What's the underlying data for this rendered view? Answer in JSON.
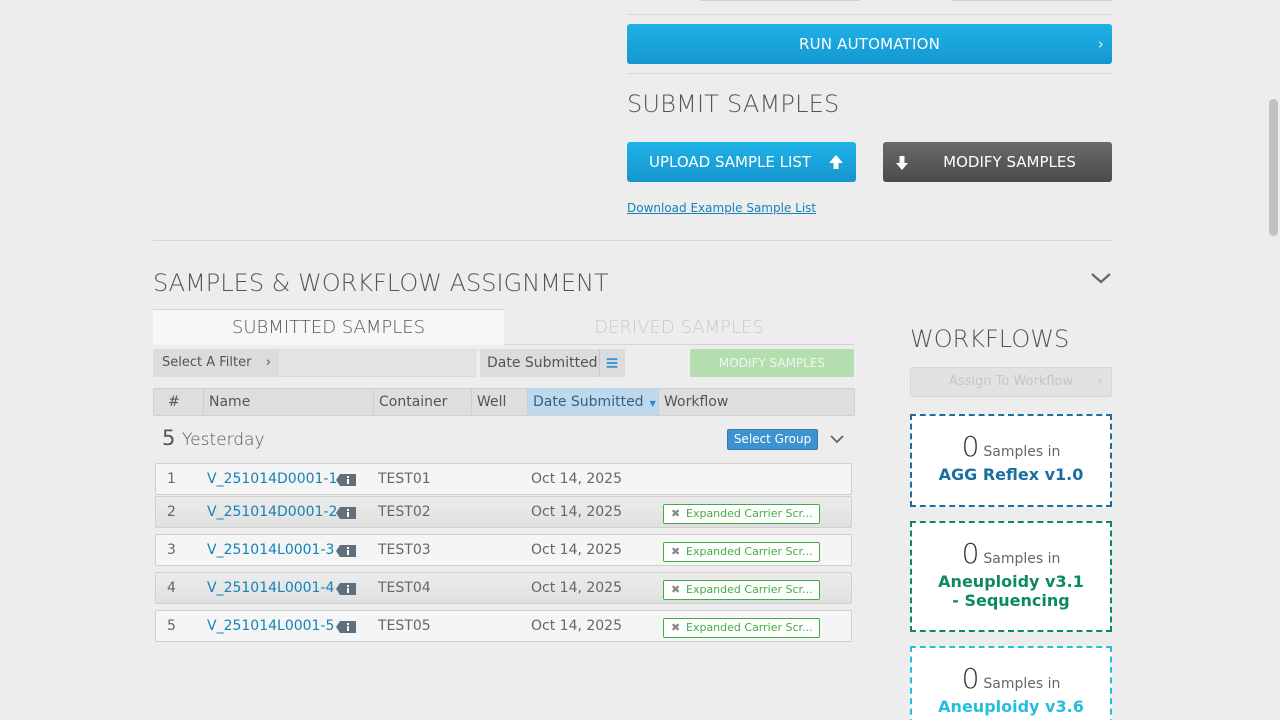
{
  "automation": {
    "run_label": "RUN AUTOMATION"
  },
  "submit": {
    "title": "SUBMIT SAMPLES",
    "upload_label": "UPLOAD SAMPLE LIST",
    "modify_label": "MODIFY SAMPLES",
    "download_link": "Download Example Sample List"
  },
  "samples_section": {
    "title": "SAMPLES & WORKFLOW ASSIGNMENT",
    "tabs": [
      {
        "label": "SUBMITTED SAMPLES",
        "active": true
      },
      {
        "label": "DERIVED SAMPLES",
        "active": false
      }
    ],
    "filter_label": "Select A Filter",
    "sort_label": "Date Submitted",
    "modify_button": "MODIFY SAMPLES",
    "columns": [
      "#",
      "Name",
      "Container",
      "Well",
      "Date Submitted",
      "Workflow"
    ],
    "group": {
      "count": "5",
      "label": "Yesterday",
      "select_label": "Select Group"
    },
    "rows": [
      {
        "num": "1",
        "name": "V_251014D0001-1",
        "container": "TEST01",
        "well": "",
        "date": "Oct 14, 2025",
        "workflow": ""
      },
      {
        "num": "2",
        "name": "V_251014D0001-2",
        "container": "TEST02",
        "well": "",
        "date": "Oct 14, 2025",
        "workflow": "Expanded Carrier Scr..."
      },
      {
        "num": "3",
        "name": "V_251014L0001-3",
        "container": "TEST03",
        "well": "",
        "date": "Oct 14, 2025",
        "workflow": "Expanded Carrier Scr..."
      },
      {
        "num": "4",
        "name": "V_251014L0001-4",
        "container": "TEST04",
        "well": "",
        "date": "Oct 14, 2025",
        "workflow": "Expanded Carrier Scr..."
      },
      {
        "num": "5",
        "name": "V_251014L0001-5",
        "container": "TEST05",
        "well": "",
        "date": "Oct 14, 2025",
        "workflow": "Expanded Carrier Scr..."
      }
    ]
  },
  "workflows": {
    "title": "WORKFLOWS",
    "assign_label": "Assign To Workflow",
    "samples_in": "Samples in",
    "cards": [
      {
        "count": "0",
        "name": "AGG Reflex v1.0",
        "color": "#1a6fa0"
      },
      {
        "count": "0",
        "name": "Aneuploidy v3.1 - Sequencing",
        "color": "#0b8a5f"
      },
      {
        "count": "0",
        "name": "Aneuploidy v3.6",
        "color": "#27bde0"
      }
    ]
  },
  "colors": {
    "primary": "#1596cf",
    "dark_button": "#4b4b4b",
    "success": "#3fae3f",
    "link": "#1582b8"
  }
}
